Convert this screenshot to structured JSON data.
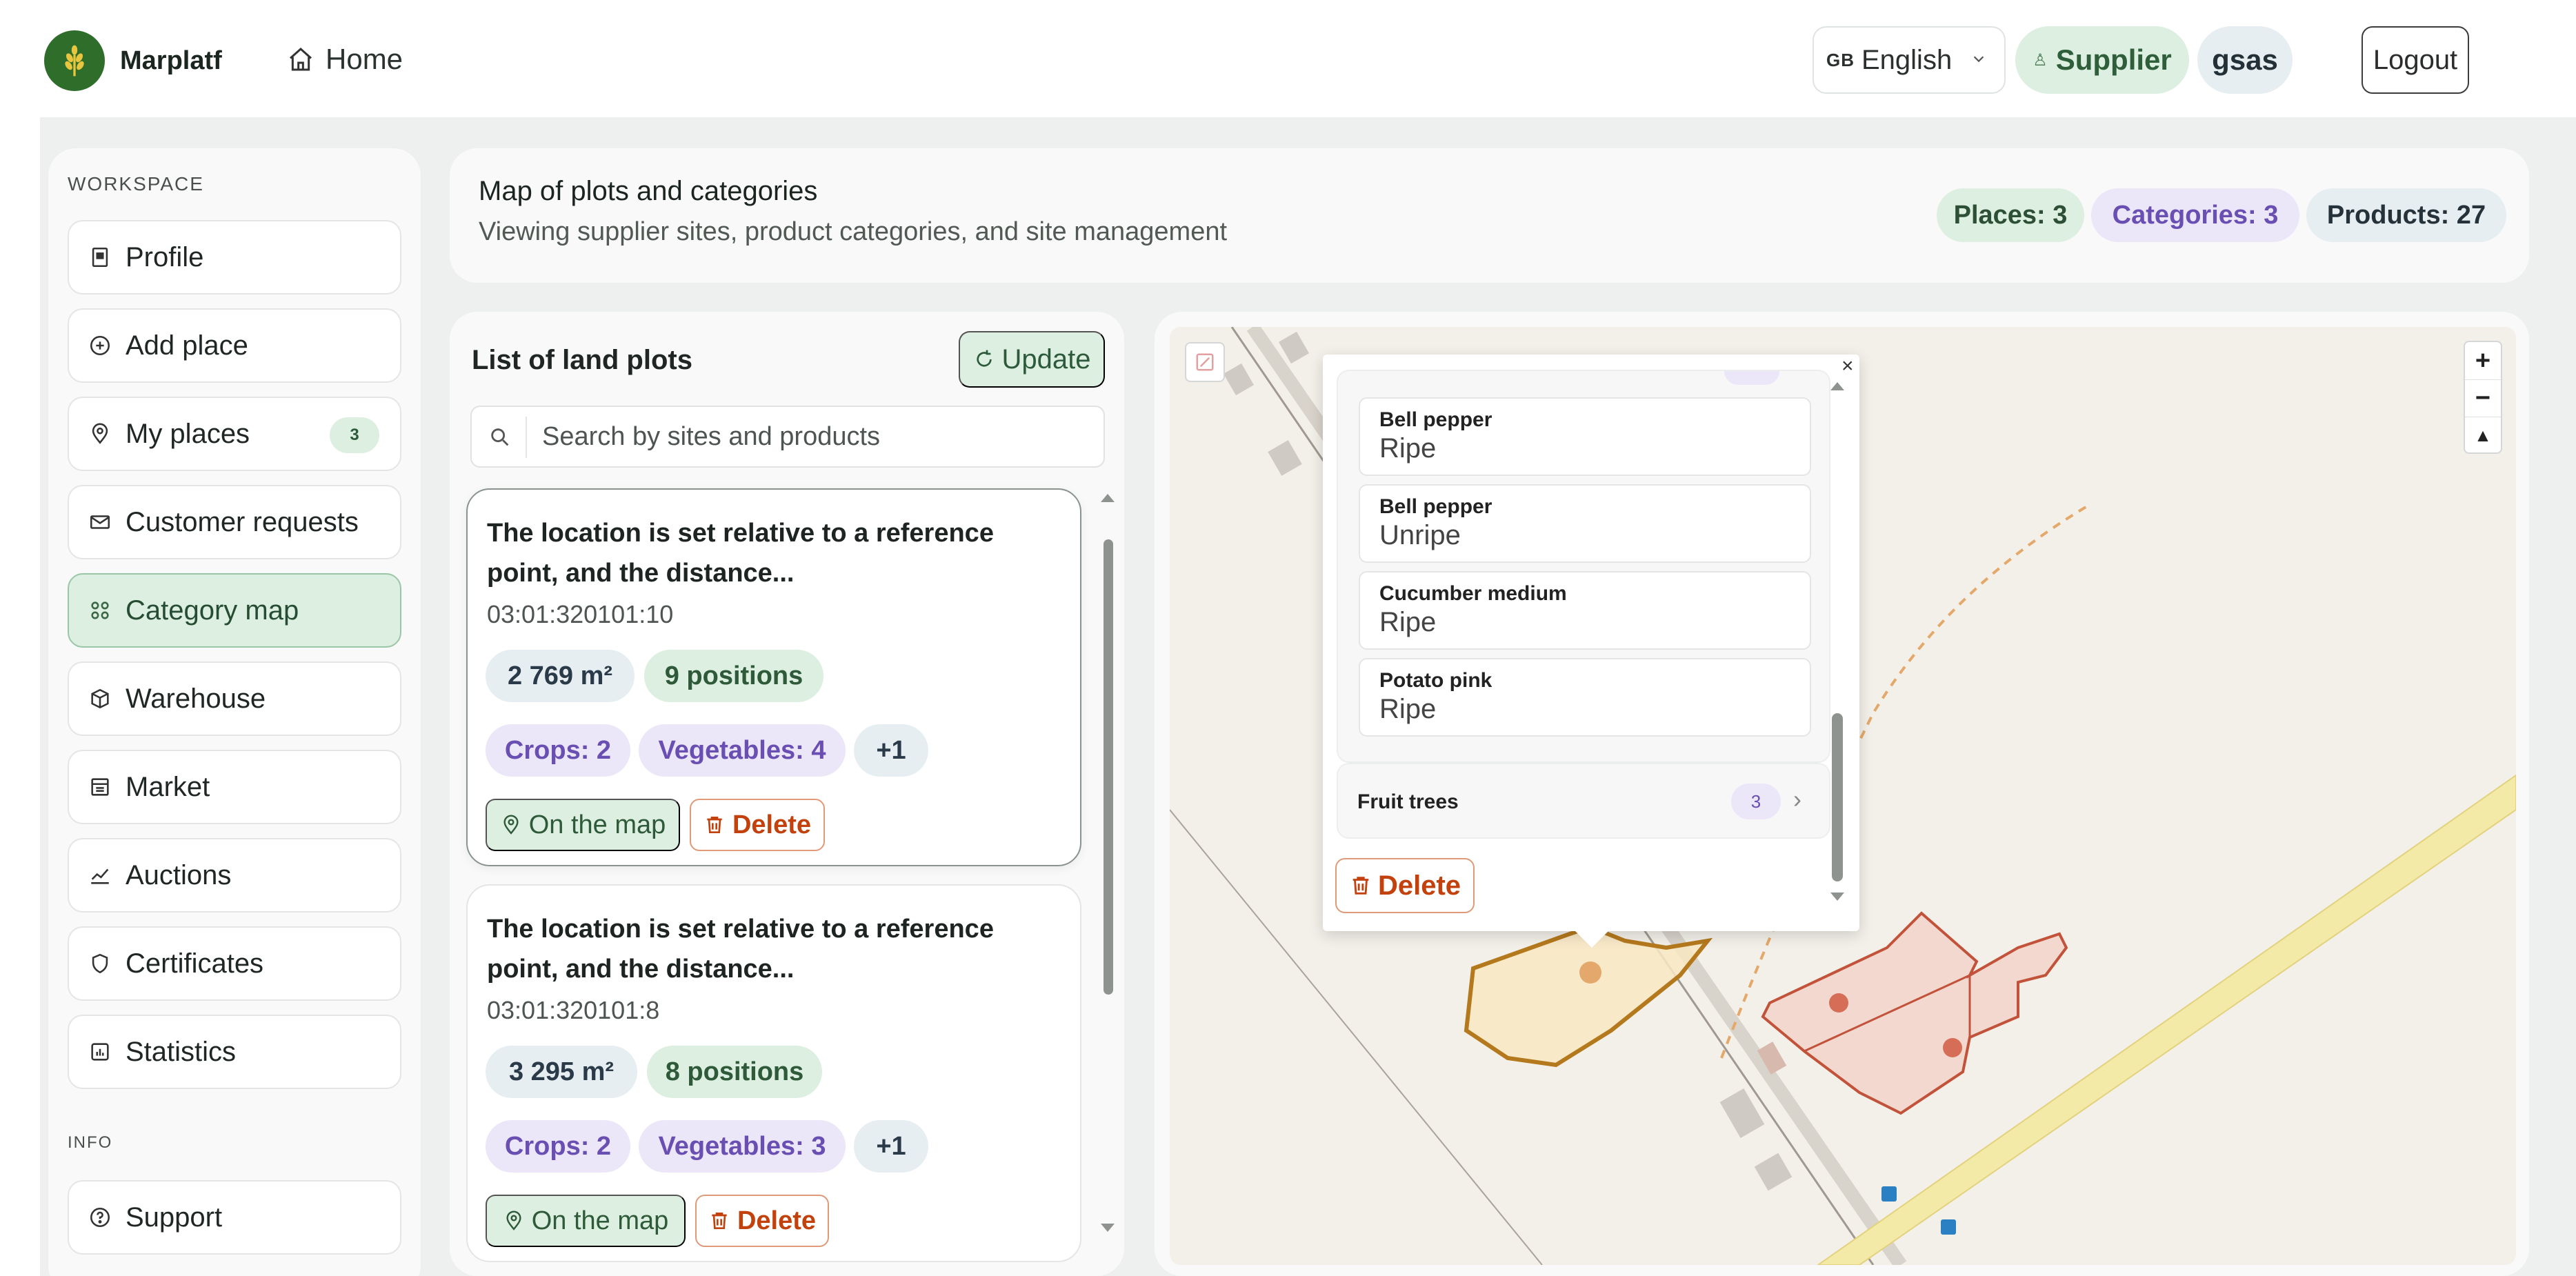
{
  "app": {
    "brand": "Marplatf",
    "home_label": "Home",
    "language": {
      "flag": "GB",
      "label": "English"
    },
    "role_label": "Supplier",
    "user_label": "gsas",
    "logout_label": "Logout"
  },
  "sidebar": {
    "workspace_heading": "WORKSPACE",
    "info_heading": "INFO",
    "items": [
      {
        "label": "Profile",
        "icon": "id-card-icon"
      },
      {
        "label": "Add place",
        "icon": "plus-circle-icon"
      },
      {
        "label": "My places",
        "icon": "pin-icon",
        "badge": "3"
      },
      {
        "label": "Customer requests",
        "icon": "mail-icon"
      },
      {
        "label": "Category map",
        "icon": "grid-icon",
        "active": true
      },
      {
        "label": "Warehouse",
        "icon": "box-icon"
      },
      {
        "label": "Market",
        "icon": "store-icon"
      },
      {
        "label": "Auctions",
        "icon": "trend-icon"
      },
      {
        "label": "Certificates",
        "icon": "shield-icon"
      },
      {
        "label": "Statistics",
        "icon": "chart-icon"
      }
    ],
    "info_items": [
      {
        "label": "Support",
        "icon": "help-icon"
      }
    ]
  },
  "header": {
    "title": "Map of plots and categories",
    "subtitle": "Viewing supplier sites, product categories, and site management",
    "stats": {
      "places": "Places: 3",
      "categories": "Categories: 3",
      "products": "Products: 27"
    }
  },
  "plot_list": {
    "title": "List of land plots",
    "update_label": "Update",
    "search_placeholder": "Search by sites and products",
    "plots": [
      {
        "title": "The location is set relative to a reference point, and the distance...",
        "cadastral": "03:01:320101:10",
        "area": "2 769 m²",
        "positions": "9 positions",
        "crops": "Crops: 2",
        "vegetables": "Vegetables: 4",
        "more": "+1",
        "map_label": "On the map",
        "delete_label": "Delete"
      },
      {
        "title": "The location is set relative to a reference point, and the distance...",
        "cadastral": "03:01:320101:8",
        "area": "3 295 m²",
        "positions": "8 positions",
        "crops": "Crops: 2",
        "vegetables": "Vegetables: 3",
        "more": "+1",
        "map_label": "On the map",
        "delete_label": "Delete"
      }
    ]
  },
  "map": {
    "zoom_in": "+",
    "zoom_out": "−",
    "compass": "▲",
    "popup": {
      "close": "×",
      "products": [
        {
          "name": "Bell pepper",
          "state": "Ripe"
        },
        {
          "name": "Bell pepper",
          "state": "Unripe"
        },
        {
          "name": "Cucumber medium",
          "state": "Ripe"
        },
        {
          "name": "Potato pink",
          "state": "Ripe"
        }
      ],
      "category": {
        "name": "Fruit trees",
        "count": "3"
      },
      "delete_label": "Delete"
    },
    "colors": {
      "accent_green": "#2f6d2b",
      "selected_plot": "#b5791d",
      "other_plots": "#c2533a",
      "main_road": "#f3e8a6"
    }
  }
}
